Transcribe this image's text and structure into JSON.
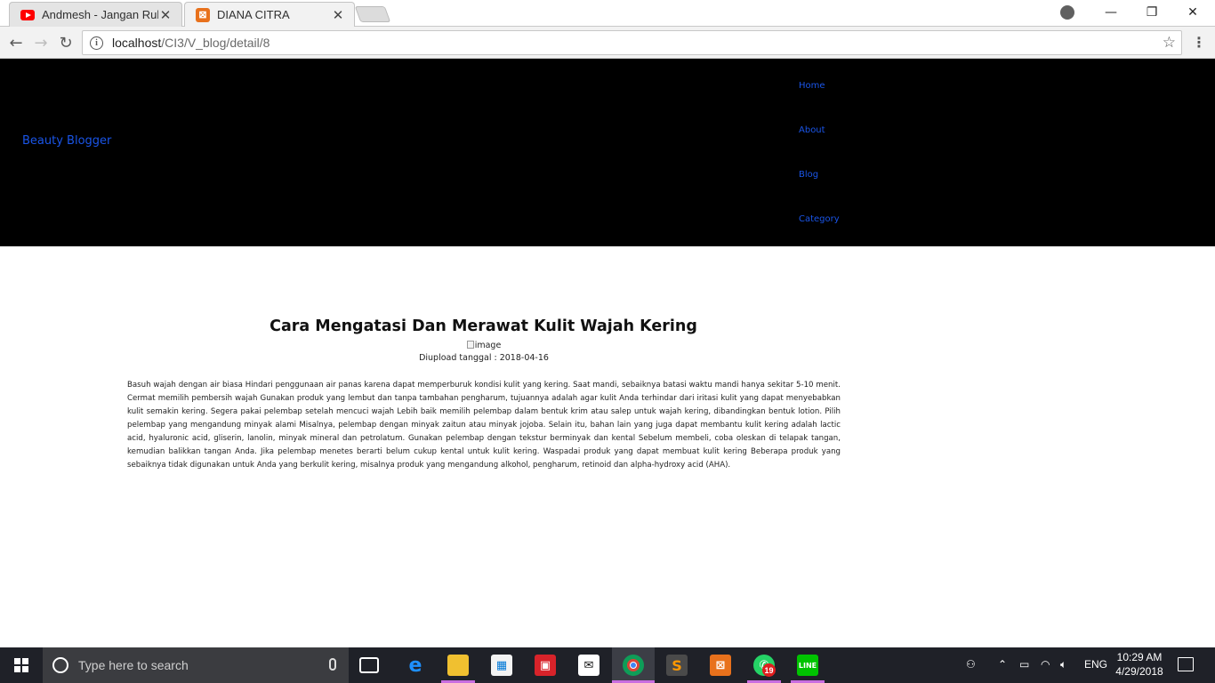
{
  "browser": {
    "tabs": [
      {
        "title": "Andmesh - Jangan Rubah",
        "icon": "youtube-icon"
      },
      {
        "title": "DIANA CITRA",
        "icon": "xampp-icon"
      }
    ],
    "url_host": "localhost",
    "url_path": "/CI3/V_blog/detail/8"
  },
  "site": {
    "brand": "Beauty Blogger",
    "nav": [
      "Home",
      "About",
      "Blog",
      "Category"
    ],
    "colors": {
      "header_bg": "#000000",
      "link": "#1a55e8"
    }
  },
  "article": {
    "title": "Cara Mengatasi Dan Merawat Kulit Wajah Kering",
    "image_alt": "image",
    "upload_date": "Diupload tanggal : 2018-04-16",
    "body": "Basuh wajah dengan air biasa Hindari penggunaan air panas karena dapat memperburuk kondisi kulit yang kering. Saat mandi, sebaiknya batasi waktu mandi hanya sekitar 5-10 menit. Cermat memilih pembersih wajah Gunakan produk yang lembut dan tanpa tambahan pengharum, tujuannya adalah agar kulit Anda terhindar dari iritasi kulit yang dapat menyebabkan kulit semakin kering. Segera pakai pelembap setelah mencuci wajah Lebih baik memilih pelembap dalam bentuk krim atau salep untuk wajah kering, dibandingkan bentuk lotion. Pilih pelembap yang mengandung minyak alami Misalnya, pelembap dengan minyak zaitun atau minyak jojoba. Selain itu, bahan lain yang juga dapat membantu kulit kering adalah lactic acid, hyaluronic acid, gliserin, lanolin, minyak mineral dan petrolatum. Gunakan pelembap dengan tekstur berminyak dan kental Sebelum membeli, coba oleskan di telapak tangan, kemudian balikkan tangan Anda. Jika pelembap menetes berarti belum cukup kental untuk kulit kering. Waspadai produk yang dapat membuat kulit kering Beberapa produk yang sebaiknya tidak digunakan untuk Anda yang berkulit kering, misalnya produk yang mengandung alkohol, pengharum, retinoid dan alpha-hydroxy acid (AHA)."
  },
  "taskbar": {
    "search_placeholder": "Type here to search",
    "whatsapp_badge": "19",
    "language": "ENG",
    "time": "10:29 AM",
    "date": "4/29/2018"
  }
}
